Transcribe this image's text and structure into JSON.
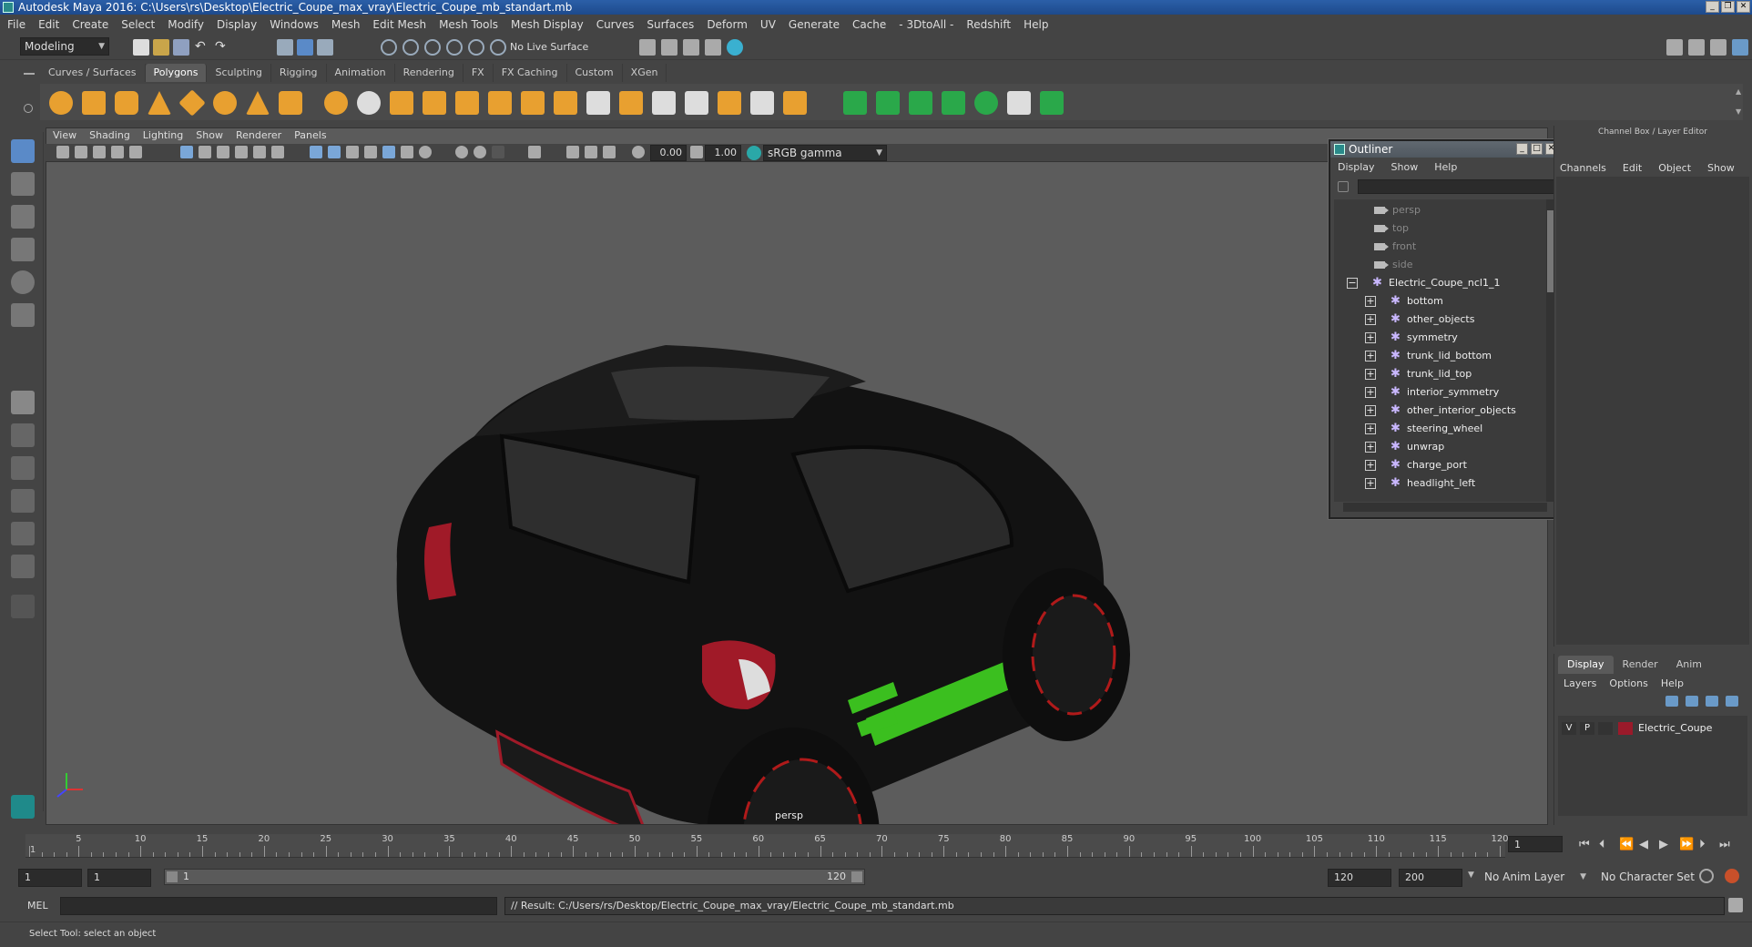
{
  "window": {
    "title": "Autodesk Maya 2016: C:\\Users\\rs\\Desktop\\Electric_Coupe_max_vray\\Electric_Coupe_mb_standart.mb"
  },
  "menubar": [
    "File",
    "Edit",
    "Create",
    "Select",
    "Modify",
    "Display",
    "Windows",
    "Mesh",
    "Edit Mesh",
    "Mesh Tools",
    "Mesh Display",
    "Curves",
    "Surfaces",
    "Deform",
    "UV",
    "Generate",
    "Cache",
    "- 3DtoAll -",
    "Redshift",
    "Help"
  ],
  "statusline": {
    "mode": "Modeling",
    "live_surface": "No Live Surface"
  },
  "shelf_tabs": [
    "Curves / Surfaces",
    "Polygons",
    "Sculpting",
    "Rigging",
    "Animation",
    "Rendering",
    "FX",
    "FX Caching",
    "Custom",
    "XGen"
  ],
  "shelf_active": "Polygons",
  "viewport": {
    "menu": [
      "View",
      "Shading",
      "Lighting",
      "Show",
      "Renderer",
      "Panels"
    ],
    "exposure": "0.00",
    "gamma": "1.00",
    "color_space": "sRGB gamma",
    "camera_label": "persp"
  },
  "outliner": {
    "title": "Outliner",
    "menu": [
      "Display",
      "Show",
      "Help"
    ],
    "cameras": [
      "persp",
      "top",
      "front",
      "side"
    ],
    "root": "Electric_Coupe_ncl1_1",
    "children": [
      "bottom",
      "other_objects",
      "symmetry",
      "trunk_lid_bottom",
      "trunk_lid_top",
      "interior_symmetry",
      "other_interior_objects",
      "steering_wheel",
      "unwrap",
      "charge_port",
      "headlight_left"
    ]
  },
  "channel_box": {
    "title": "Channel Box / Layer Editor",
    "menu": [
      "Channels",
      "Edit",
      "Object",
      "Show"
    ]
  },
  "layer_editor": {
    "tabs": [
      "Display",
      "Render",
      "Anim"
    ],
    "active_tab": "Display",
    "menu": [
      "Layers",
      "Options",
      "Help"
    ],
    "layer": {
      "v": "V",
      "p": "P",
      "name": "Electric_Coupe",
      "color": "#9a1a2a"
    }
  },
  "timeline": {
    "ticks": [
      1,
      5,
      10,
      15,
      20,
      25,
      30,
      35,
      40,
      45,
      50,
      55,
      60,
      65,
      70,
      75,
      80,
      85,
      90,
      95,
      100,
      105,
      110,
      115,
      120
    ],
    "current_frame": "1"
  },
  "range": {
    "start": "1",
    "playback_start": "1",
    "slider_start": "1",
    "slider_end": "120",
    "playback_end": "120",
    "end": "200",
    "anim_layer": "No Anim Layer",
    "character_set": "No Character Set"
  },
  "command": {
    "lang": "MEL",
    "result": "// Result: C:/Users/rs/Desktop/Electric_Coupe_max_vray/Electric_Coupe_mb_standart.mb"
  },
  "help": "Select Tool: select an object",
  "colors": {
    "accent_green": "#2aa84a",
    "shelf_orange": "#e8a030",
    "car_stripe": "#3bbf1f"
  }
}
